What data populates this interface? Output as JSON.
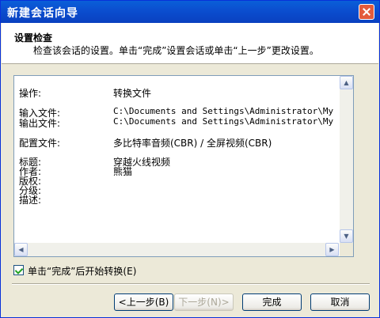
{
  "window": {
    "title": "新建会话向导"
  },
  "header": {
    "title": "设置检查",
    "description": "检查该会话的设置。单击“完成”设置会话或单击“上一步”更改设置。"
  },
  "summary": {
    "operation": {
      "key": "操作:",
      "value": "转换文件"
    },
    "input_file": {
      "key": "输入文件:",
      "value": "C:\\Documents and Settings\\Administrator\\My Docume"
    },
    "output_file": {
      "key": "输出文件:",
      "value": "C:\\Documents and Settings\\Administrator\\My Docume"
    },
    "profile": {
      "key": "配置文件:",
      "value": "多比特率音频(CBR) / 全屏视频(CBR)"
    },
    "title": {
      "key": "标题:",
      "value": "穿越火线视频"
    },
    "author": {
      "key": "作者:",
      "value": "熊猫"
    },
    "copyright": {
      "key": "版权:",
      "value": ""
    },
    "rating": {
      "key": "分级:",
      "value": ""
    },
    "description": {
      "key": "描述:",
      "value": ""
    }
  },
  "options": {
    "start_convert_label": "单击“完成”后开始转换(E)",
    "start_convert_checked": true
  },
  "buttons": {
    "back": "<上一步(B)",
    "next": "下一步(N)>",
    "finish": "完成",
    "cancel": "取消"
  }
}
